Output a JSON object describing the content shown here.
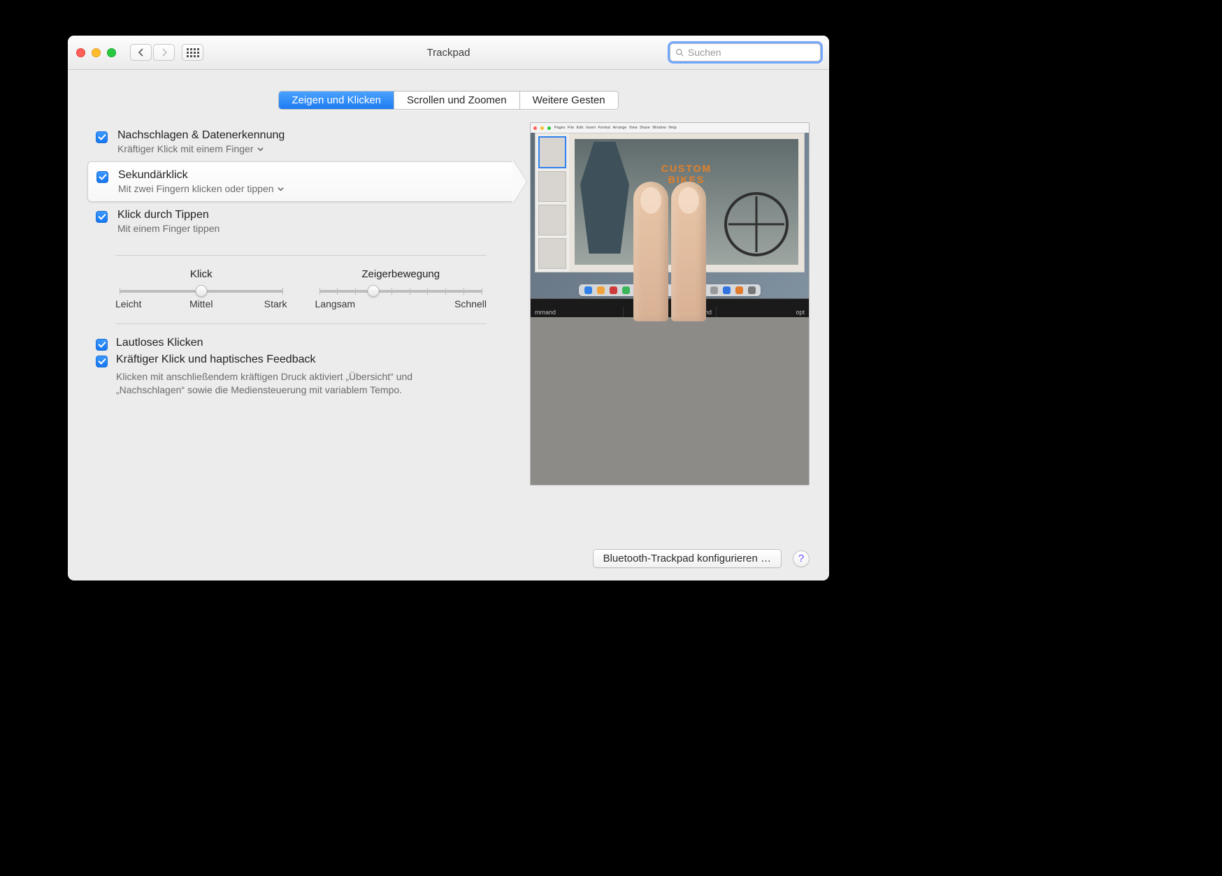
{
  "window": {
    "title": "Trackpad"
  },
  "search": {
    "placeholder": "Suchen"
  },
  "tabs": [
    {
      "label": "Zeigen und Klicken",
      "active": true
    },
    {
      "label": "Scrollen und Zoomen",
      "active": false
    },
    {
      "label": "Weitere Gesten",
      "active": false
    }
  ],
  "options": {
    "lookup": {
      "title": "Nachschlagen & Datenerkennung",
      "subtitle": "Kräftiger Klick mit einem Finger",
      "checked": true
    },
    "secondary": {
      "title": "Sekundärklick",
      "subtitle": "Mit zwei Fingern klicken oder tippen",
      "checked": true,
      "selected": true
    },
    "tap": {
      "title": "Klick durch Tippen",
      "subtitle": "Mit einem Finger tippen",
      "checked": true
    }
  },
  "sliders": {
    "click": {
      "title": "Klick",
      "labels": [
        "Leicht",
        "Mittel",
        "Stark"
      ],
      "ticks": 3,
      "value_pct": 50
    },
    "tracking": {
      "title": "Zeigerbewegung",
      "labels": [
        "Langsam",
        "Schnell"
      ],
      "ticks": 10,
      "value_pct": 33
    }
  },
  "bottom": {
    "silent": {
      "label": "Lautloses Klicken",
      "checked": true
    },
    "force": {
      "label": "Kräftiger Klick und haptisches Feedback",
      "checked": true,
      "description": "Klicken mit anschließendem kräftigen Druck aktiviert „Übersicht“ und „Nachschlagen“ sowie die Mediensteuerung mit variablem Tempo."
    }
  },
  "preview": {
    "hero_line1": "CUSTOM",
    "hero_line2": "BIKES",
    "key_left": "mmand",
    "key_mid": "command",
    "key_right": "opt",
    "dock_colors": [
      "#2f7fe6",
      "#f2a23c",
      "#cf3b3b",
      "#3bb55a",
      "#7b4fe0",
      "#e64c8a",
      "#2aa0c8",
      "#f0c419",
      "#4c4c4c",
      "#15a0a0",
      "#999999",
      "#3174e0",
      "#e07b2f",
      "#777"
    ]
  },
  "footer": {
    "configure": "Bluetooth-Trackpad konfigurieren …",
    "help": "?"
  }
}
